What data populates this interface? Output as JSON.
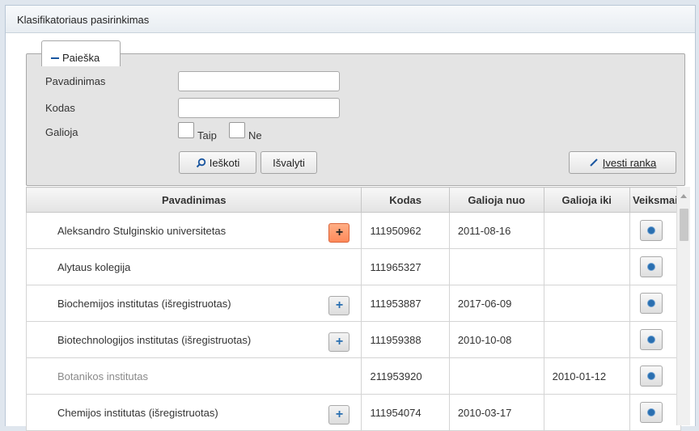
{
  "window": {
    "title": "Klasifikatoriaus pasirinkimas"
  },
  "search": {
    "legend": "Paieška",
    "fields": {
      "name_label": "Pavadinimas",
      "name_value": "",
      "code_label": "Kodas",
      "code_value": "",
      "valid_label": "Galioja",
      "yes_label": "Taip",
      "no_label": "Ne"
    },
    "search_button": "Ieškoti",
    "clear_button": "Išvalyti",
    "manual_button": "Įvesti ranka"
  },
  "table": {
    "columns": [
      "Pavadinimas",
      "Kodas",
      "Galioja nuo",
      "Galioja iki",
      "Veiksmai"
    ],
    "rows": [
      {
        "name": "Aleksandro Stulginskio universitetas",
        "code": "111950962",
        "from": "2011-08-16",
        "to": "",
        "plus": true,
        "plus_active": true,
        "dimmed": false
      },
      {
        "name": "Alytaus kolegija",
        "code": "111965327",
        "from": "",
        "to": "",
        "plus": false,
        "plus_active": false,
        "dimmed": false
      },
      {
        "name": "Biochemijos institutas (išregistruotas)",
        "code": "111953887",
        "from": "2017-06-09",
        "to": "",
        "plus": true,
        "plus_active": false,
        "dimmed": false
      },
      {
        "name": "Biotechnologijos institutas (išregistruotas)",
        "code": "111959388",
        "from": "2010-10-08",
        "to": "",
        "plus": true,
        "plus_active": false,
        "dimmed": false
      },
      {
        "name": "Botanikos institutas",
        "code": "211953920",
        "from": "",
        "to": "2010-01-12",
        "plus": false,
        "plus_active": false,
        "dimmed": true
      },
      {
        "name": "Chemijos institutas (išregistruotas)",
        "code": "111954074",
        "from": "2010-03-17",
        "to": "",
        "plus": true,
        "plus_active": false,
        "dimmed": false
      }
    ]
  }
}
